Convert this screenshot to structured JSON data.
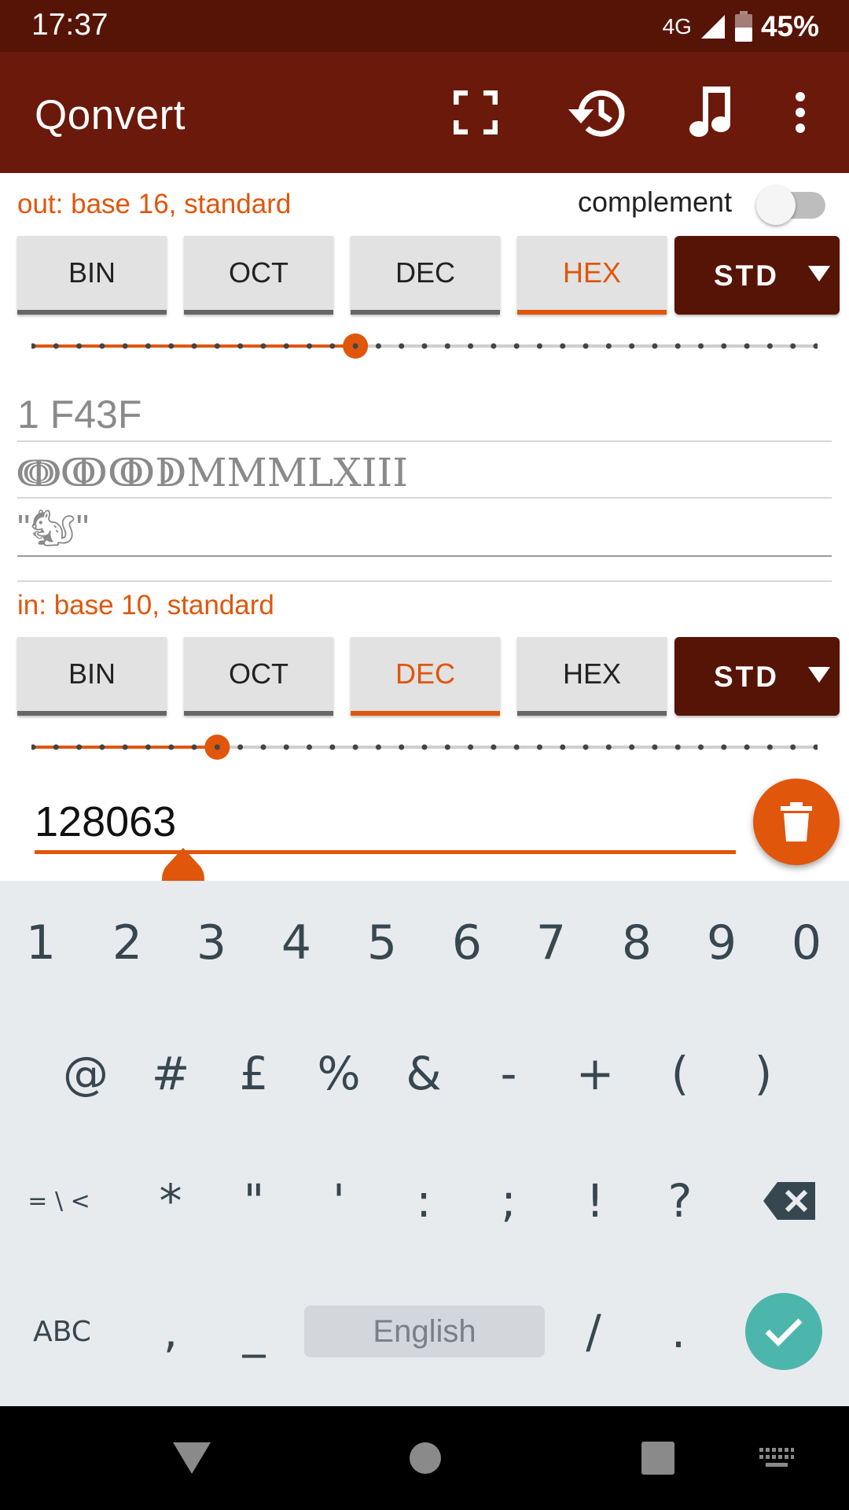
{
  "status_bar": {
    "time": "17:37",
    "network": "4G",
    "battery": "45%"
  },
  "app_bar": {
    "title": "Qonvert",
    "icons": [
      "fullscreen-icon",
      "history-icon",
      "music-note-icon",
      "more-vert-icon"
    ]
  },
  "output": {
    "label": "out: base 16, standard",
    "complement_label": "complement",
    "complement_on": false,
    "bases": [
      "BIN",
      "OCT",
      "DEC",
      "HEX"
    ],
    "active_base": "HEX",
    "std_label": "STD",
    "slider_value": 16,
    "slider_max": 36,
    "results": {
      "hex": "1 F43F",
      "roman": "ↈↂↂↁMMMLXIII",
      "char": "\"🐿\""
    }
  },
  "input": {
    "label": "in: base 10, standard",
    "bases": [
      "BIN",
      "OCT",
      "DEC",
      "HEX"
    ],
    "active_base": "DEC",
    "std_label": "STD",
    "slider_value": 10,
    "slider_max": 36,
    "value": "128063"
  },
  "keyboard": {
    "row1": [
      "1",
      "2",
      "3",
      "4",
      "5",
      "6",
      "7",
      "8",
      "9",
      "0"
    ],
    "row2": [
      "@",
      "#",
      "£",
      "%",
      "&",
      "-",
      "+",
      "(",
      ")"
    ],
    "row3": [
      "= \\ <",
      "*",
      "\"",
      "'",
      ":",
      ";",
      "!",
      "?"
    ],
    "row4": {
      "abc": "ABC",
      "comma": ",",
      "underscore": "_",
      "space": "English",
      "slash": "/",
      "period": "."
    }
  },
  "colors": {
    "status_bar": "#561407",
    "app_bar": "#6a190a",
    "accent": "#e0560b",
    "std_button": "#561407",
    "enter_key": "#4db6ac"
  }
}
